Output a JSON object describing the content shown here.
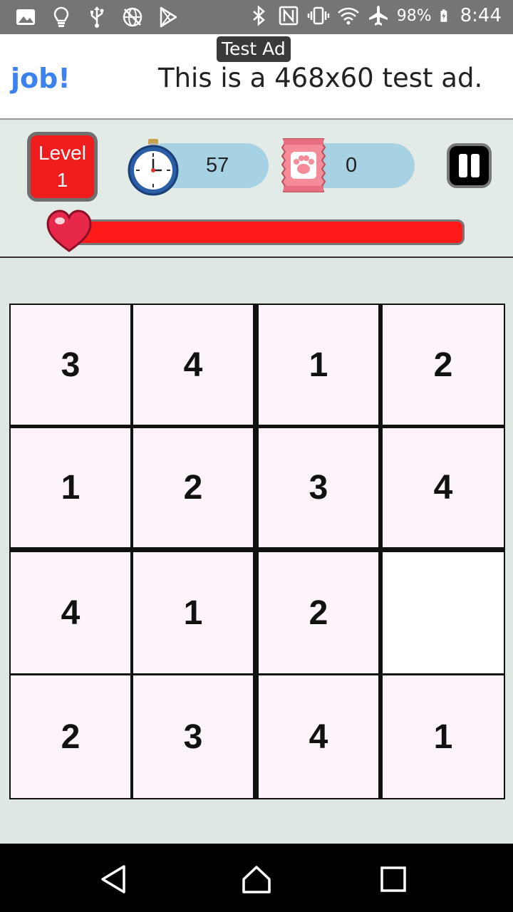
{
  "status_bar": {
    "left_icons": [
      "image-icon",
      "lightbulb-icon",
      "usb-icon",
      "globe-off-icon",
      "play-store-icon"
    ],
    "right_icons": [
      "bluetooth-icon",
      "nfc-icon",
      "vibrate-icon",
      "wifi-icon",
      "airplane-icon",
      "battery-icon"
    ],
    "battery": "98%",
    "time": "8:44"
  },
  "ad": {
    "tag": "Test Ad",
    "left_text": "e job!",
    "main_text": "This is a 468x60 test ad."
  },
  "header": {
    "level_label": "Level",
    "level_value": "1",
    "timer_value": "57",
    "treats_value": "0",
    "health_fraction": 1.0
  },
  "board": {
    "size": 4,
    "cells": [
      [
        "3",
        "4",
        "1",
        "2"
      ],
      [
        "1",
        "2",
        "3",
        "4"
      ],
      [
        "4",
        "1",
        "2",
        ""
      ],
      [
        "2",
        "3",
        "4",
        "1"
      ]
    ]
  },
  "nav": {
    "buttons": [
      "back-icon",
      "home-icon",
      "recents-icon"
    ]
  },
  "colors": {
    "level_bg": "#ee1c1c",
    "pill_bg": "#a6d2e4",
    "health": "#ff1a1a",
    "cell_bg": "#fdf3fa",
    "ad_link": "#3b82f0"
  }
}
